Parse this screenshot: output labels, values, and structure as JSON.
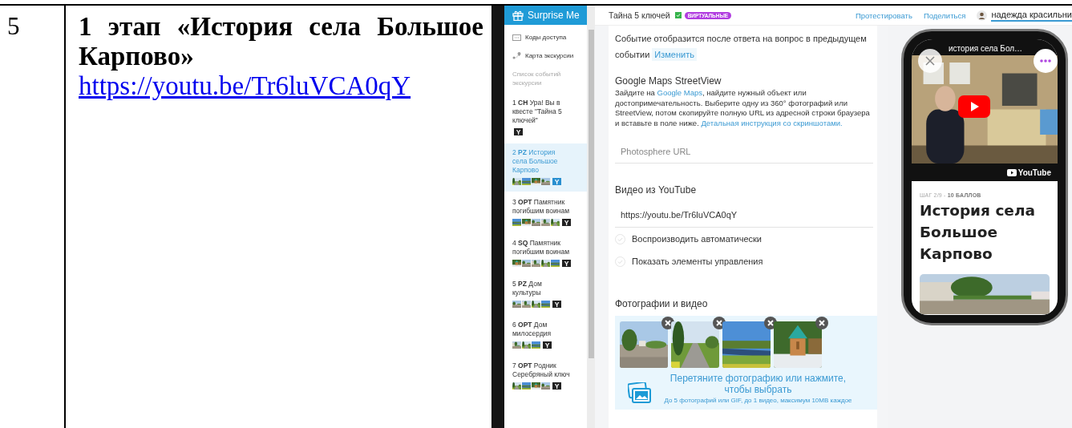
{
  "document": {
    "row_number": "5",
    "cell_title": "1 этап «История села Большое Карпово»",
    "cell_link": "https://youtu.be/Tr6luVCA0qY"
  },
  "app": {
    "logo": "Surprise Me",
    "sidebar": {
      "links": [
        {
          "kind": "codes",
          "label": "Коды доступа"
        },
        {
          "kind": "map",
          "label": "Карта экскурсии"
        }
      ],
      "section_label": "Список событий экскурсии",
      "events": [
        {
          "label": "1 **СН** Ура! Вы в квесте \"Тайна 5 ключей\"",
          "badge": "Y",
          "selected": false
        },
        {
          "label": "2 **PZ** История села Большое Карпово",
          "badge": "Y",
          "selected": true
        },
        {
          "label": "3 **ОРТ** Памятник погибшим воинам",
          "badge": "Y",
          "selected": false
        },
        {
          "label": "4 **SQ** Памятник погибшим воинам",
          "badge": "Y",
          "selected": false
        },
        {
          "label": "5 **PZ** Дом культуры",
          "badge": "Y",
          "selected": false
        },
        {
          "label": "6 **ОРТ** Дом милосердия",
          "badge": "Y",
          "selected": false
        },
        {
          "label": "7 **ОРТ** Родник Серебряный ключ",
          "badge": "Y",
          "selected": false
        }
      ]
    },
    "topbar": {
      "quest_title": "Тайна 5 ключей",
      "published": true,
      "tag": "ВИРТУАЛЬНЫЕ",
      "actions": [
        "Протестировать",
        "Поделиться"
      ],
      "user": "надежда красильни"
    },
    "editor": {
      "note": "Событие отобразится после ответа на вопрос в предыдущем событии",
      "note_link": "Изменить",
      "streetview": {
        "heading": "Google Maps StreetView",
        "text_before": "Зайдите на",
        "maps_link": "Google Maps",
        "text_after": ", найдите нужный объект или достопримечательность. Выберите одну из 360° фотографий или StreetView, потом скопируйте полную URL из адресной строки браузера и вставьте в поле ниже.",
        "guide_link": "Детальная инструкция со скриншотами.",
        "placeholder": "Photosphere URL"
      },
      "youtube": {
        "heading": "Видео из YouTube",
        "value": "https://youtu.be/Tr6luVCA0qY",
        "options": [
          {
            "label": "Воспроизводить автоматически",
            "checked": false
          },
          {
            "label": "Показать элементы управления",
            "checked": false
          }
        ]
      },
      "media": {
        "heading": "Фотографии и видео",
        "drop_text": "Перетяните фотографию или нажмите, чтобы выбрать",
        "limits": "До 5 фотографий или GIF, до 1 видео, максимум 10MB каждое"
      }
    },
    "preview": {
      "video_title": "история села Бол…",
      "video_brand": "YouTube",
      "step": "ШАГ 2/9 - **10 БАЛЛОВ**",
      "title": "История села Большое Карпово"
    }
  }
}
